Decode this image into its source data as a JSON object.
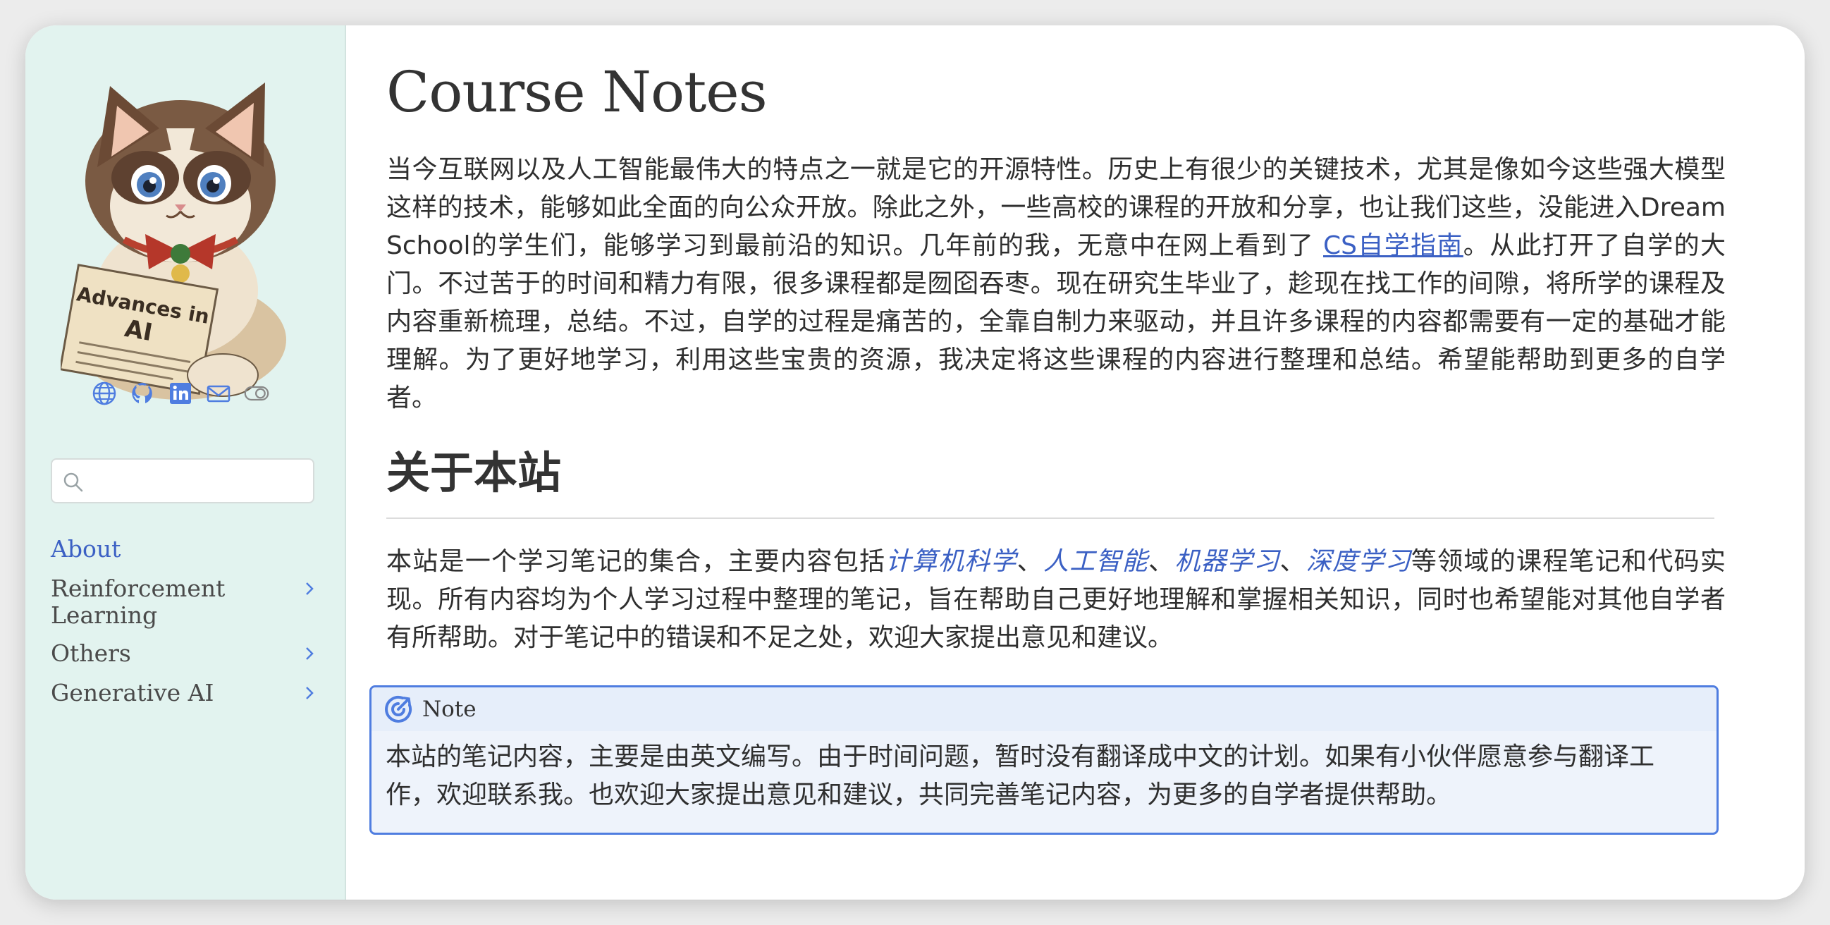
{
  "sidebar": {
    "search_placeholder": "",
    "nav": [
      {
        "label": "About",
        "active": true,
        "has_children": false
      },
      {
        "label": "Reinforcement Learning",
        "active": false,
        "has_children": true
      },
      {
        "label": "Others",
        "active": false,
        "has_children": true
      },
      {
        "label": "Generative AI",
        "active": false,
        "has_children": true
      }
    ],
    "social_icons": [
      "globe-icon",
      "github-icon",
      "linkedin-icon",
      "mail-icon",
      "theme-toggle-icon"
    ],
    "avatar": {
      "book_text_line1": "Advances in",
      "book_text_line2": "AI"
    }
  },
  "main": {
    "title": "Course Notes",
    "intro": {
      "before_link": "当今互联网以及人工智能最伟大的特点之一就是它的开源特性。历史上有很少的关键技术，尤其是像如今这些强大模型这样的技术，能够如此全面的向公众开放。除此之外，一些高校的课程的开放和分享，也让我们这些，没能进入Dream School的学生们，能够学习到最前沿的知识。几年前的我，无意中在网上看到了 ",
      "link": "CS自学指南",
      "after_link": "。从此打开了自学的大门。不过苦于的时间和精力有限，很多课程都是囫囵吞枣。现在研究生毕业了，趁现在找工作的间隙，将所学的课程及内容重新梳理，总结。不过，自学的过程是痛苦的，全靠自制力来驱动，并且许多课程的内容都需要有一定的基础才能理解。为了更好地学习，利用这些宝贵的资源，我决定将这些课程的内容进行整理和总结。希望能帮助到更多的自学者。"
    },
    "about": {
      "heading": "关于本站",
      "before": "本站是一个学习笔记的集合，主要内容包括",
      "topics": [
        "计算机科学",
        "人工智能",
        "机器学习",
        "深度学习"
      ],
      "separators": [
        "、",
        "、",
        "、"
      ],
      "after": "等领域的课程笔记和代码实现。所有内容均为个人学习过程中整理的笔记，旨在帮助自己更好地理解和掌握相关知识，同时也希望能对其他自学者有所帮助。对于笔记中的错误和不足之处，欢迎大家提出意见和建议。"
    },
    "note": {
      "title": "Note",
      "body": "本站的笔记内容，主要是由英文编写。由于时间问题，暂时没有翻译成中文的计划。如果有小伙伴愿意参与翻译工作，欢迎联系我。也欢迎大家提出意见和建议，共同完善笔记内容，为更多的自学者提供帮助。"
    }
  },
  "colors": {
    "sidebar_bg": "#e2f3ef",
    "accent": "#3b60c4",
    "note_border": "#4f7de0",
    "note_bg": "#eef3fb"
  }
}
